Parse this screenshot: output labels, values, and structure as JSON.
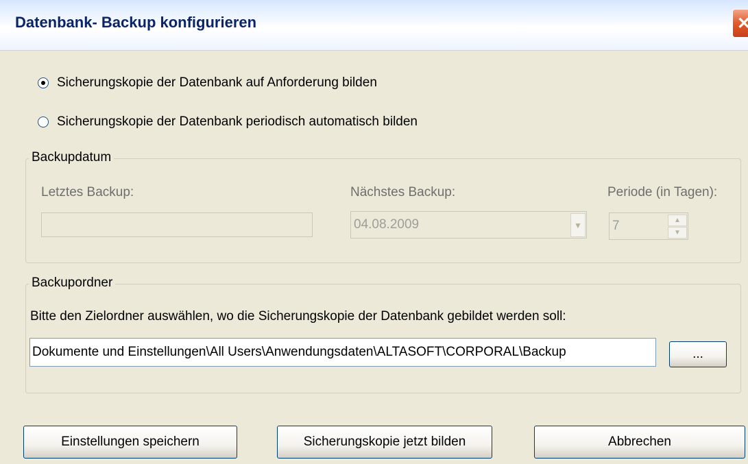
{
  "window": {
    "title": "Datenbank- Backup konfigurieren"
  },
  "backup_mode": {
    "options": [
      {
        "label": "Sicherungskopie der Datenbank auf Anforderung bilden",
        "checked": true
      },
      {
        "label": "Sicherungskopie der Datenbank periodisch automatisch bilden",
        "checked": false
      }
    ]
  },
  "backup_date": {
    "legend": "Backupdatum",
    "last_label": "Letztes Backup:",
    "last_value": "",
    "next_label": "Nächstes Backup:",
    "next_value": "04.08.2009",
    "period_label": "Periode (in Tagen):",
    "period_value": "7"
  },
  "backup_folder": {
    "legend": "Backupordner",
    "instruction": "Bitte den Zielordner auswählen, wo die Sicherungskopie der Datenbank gebildet werden soll:",
    "path": "Dokumente und Einstellungen\\All Users\\Anwendungsdaten\\ALTASOFT\\CORPORAL\\Backup",
    "browse_label": "..."
  },
  "buttons": {
    "save": "Einstellungen speichern",
    "backup_now": "Sicherungskopie jetzt bilden",
    "cancel": "Abbrechen"
  },
  "icons": {
    "close": "close-icon",
    "dropdown": "chevron-down-icon",
    "spin_up": "spin-up-icon",
    "spin_down": "spin-down-icon"
  }
}
